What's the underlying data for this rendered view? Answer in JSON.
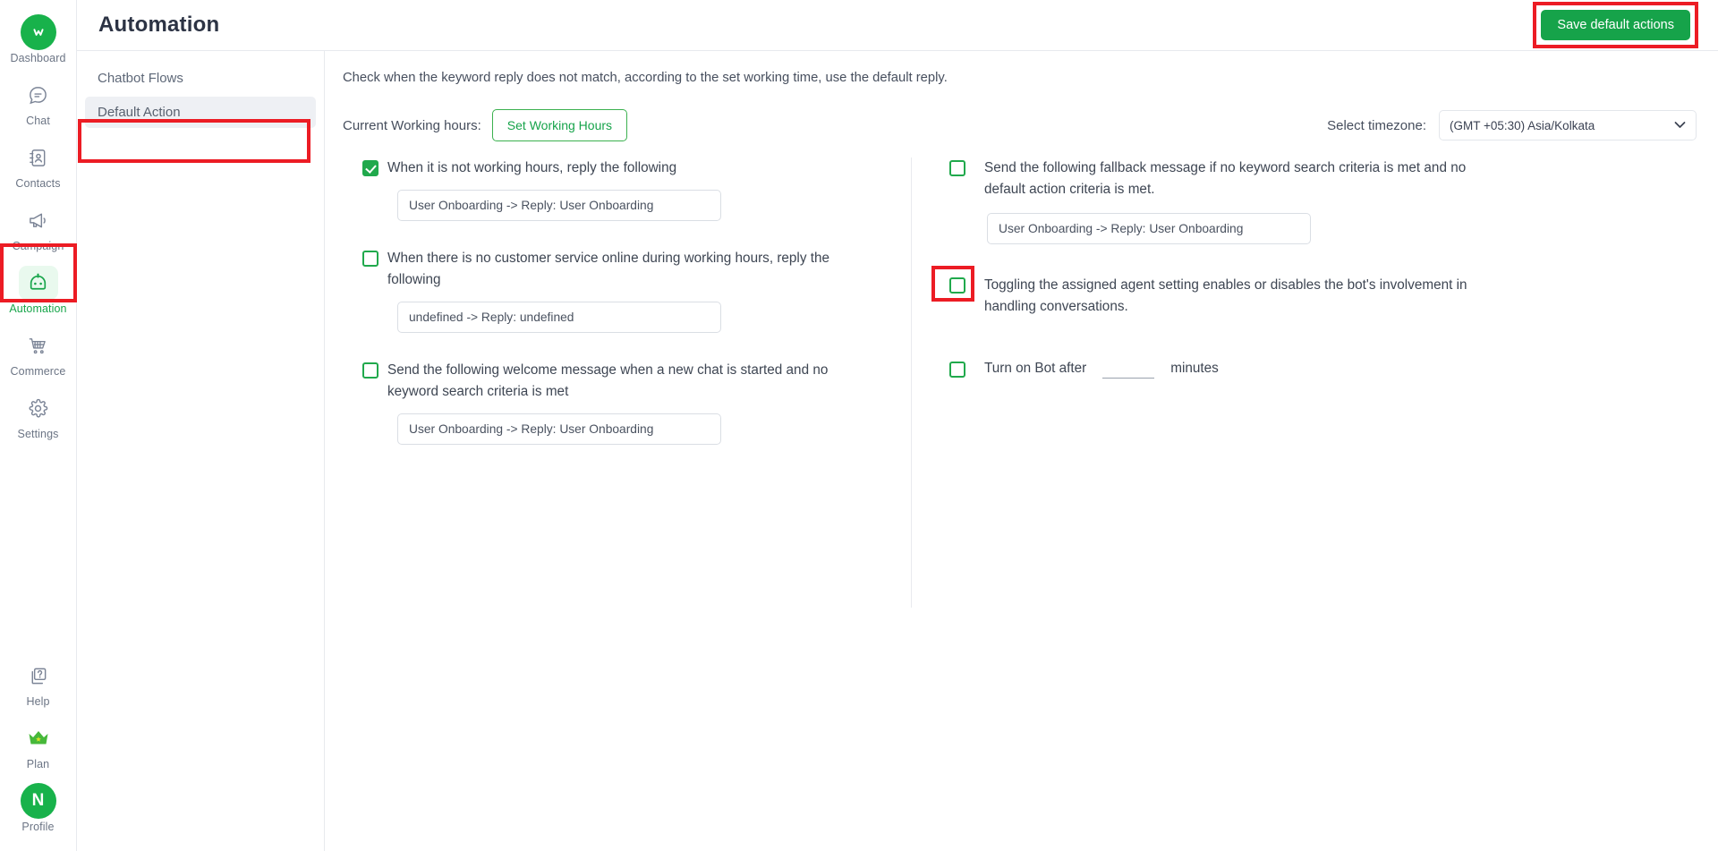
{
  "rail": {
    "top_items": [
      {
        "label": "Dashboard",
        "icon": "logo-whatsapp-chat-icon",
        "active": false
      },
      {
        "label": "Chat",
        "icon": "chat-bubble-icon",
        "active": false
      },
      {
        "label": "Contacts",
        "icon": "contacts-book-icon",
        "active": false
      },
      {
        "label": "Campaign",
        "icon": "megaphone-icon",
        "active": false
      },
      {
        "label": "Automation",
        "icon": "robot-icon",
        "active": true
      },
      {
        "label": "Commerce",
        "icon": "shopping-cart-icon",
        "active": false
      },
      {
        "label": "Settings",
        "icon": "gear-icon",
        "active": false
      }
    ],
    "bottom_items": [
      {
        "label": "Help",
        "icon": "help-question-icon"
      },
      {
        "label": "Plan",
        "icon": "crown-icon"
      },
      {
        "label": "Profile",
        "icon": "avatar-icon",
        "avatar_initial": "N"
      }
    ]
  },
  "header": {
    "title": "Automation",
    "save_label": "Save default actions"
  },
  "subnav": {
    "items": [
      {
        "label": "Chatbot Flows",
        "active": false
      },
      {
        "label": "Default Action",
        "active": true
      }
    ]
  },
  "main": {
    "intro": "Check when the keyword reply does not match, according to the set working time, use the default reply.",
    "working_hours_label": "Current Working hours:",
    "set_working_hours_label": "Set Working Hours",
    "timezone_label": "Select timezone:",
    "timezone_value": "(GMT +05:30) Asia/Kolkata",
    "left_options": [
      {
        "checked": true,
        "text": "When it is not working hours, reply the following",
        "field_value": "User Onboarding -> Reply: User Onboarding"
      },
      {
        "checked": false,
        "text": "When there is no customer service online during working hours, reply the following",
        "field_value": "undefined -> Reply: undefined"
      },
      {
        "checked": false,
        "text": "Send the following welcome message when a new chat is started and no keyword search criteria is met",
        "field_value": "User Onboarding -> Reply: User Onboarding"
      }
    ],
    "right_options": [
      {
        "checked": false,
        "text": "Send the following fallback message if no keyword search criteria is met and no default action criteria is met.",
        "field_value": "User Onboarding -> Reply: User Onboarding"
      },
      {
        "checked": false,
        "text": "Toggling the assigned agent setting enables or disables the bot's involvement in handling conversations."
      }
    ],
    "turn_on_bot": {
      "checked": false,
      "prefix_label": "Turn on Bot after",
      "minutes_value": "",
      "suffix_label": "minutes"
    }
  },
  "colors": {
    "accent_green": "#16a34a",
    "highlight_red": "#ec1c24",
    "text_dark": "#3e4653"
  }
}
